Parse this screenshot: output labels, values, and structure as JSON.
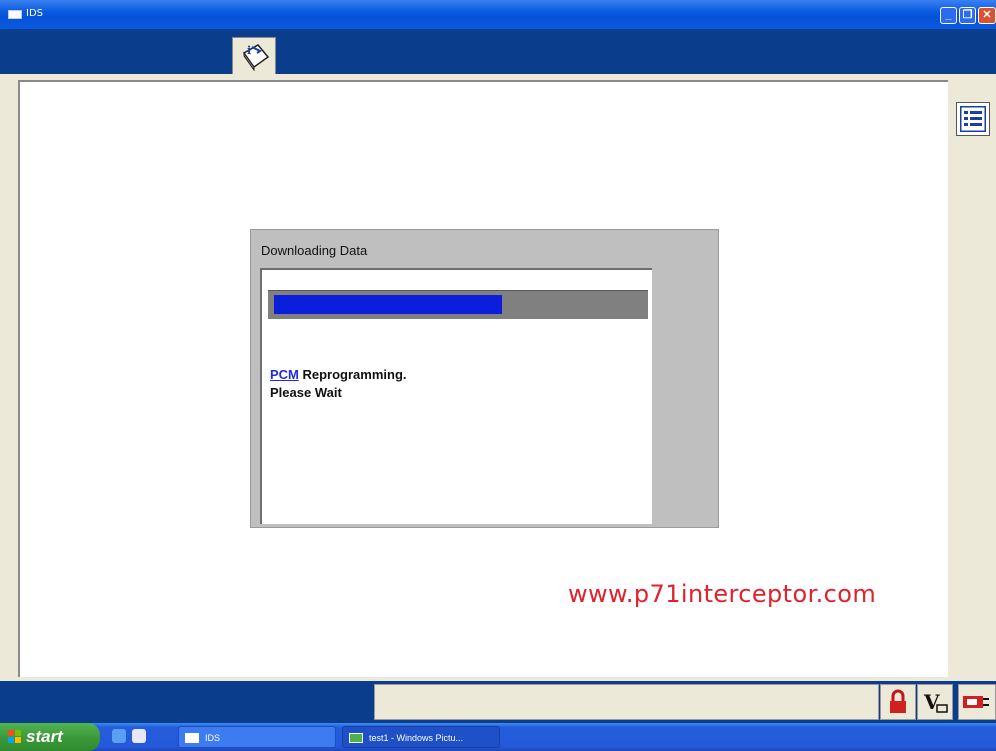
{
  "window": {
    "title": "IDS",
    "minimize_icon": "minimize-icon",
    "maximize_icon": "restore-icon",
    "close_icon": "close-icon"
  },
  "toolbar": {
    "tab_icon": "info-book-icon"
  },
  "side": {
    "list_icon": "list-icon"
  },
  "dialog": {
    "title": "Downloading Data",
    "progress": 0.62,
    "message_link": "PCM",
    "message_rest": " Reprogramming.",
    "message_line2": "Please Wait"
  },
  "watermark": "www.p71interceptor.com",
  "statusbar": {
    "status_text": "",
    "icons": [
      "lock-icon",
      "vbatt-icon",
      "vehicle-link-icon"
    ]
  },
  "taskbar": {
    "start_label": "start",
    "tasks": [
      {
        "label": "IDS"
      },
      {
        "label": "test1 - Windows Pictu..."
      }
    ]
  },
  "colors": {
    "progress_fill": "#0A1EDC",
    "watermark": "#E0222C",
    "app_bar": "#0A3E8C"
  }
}
